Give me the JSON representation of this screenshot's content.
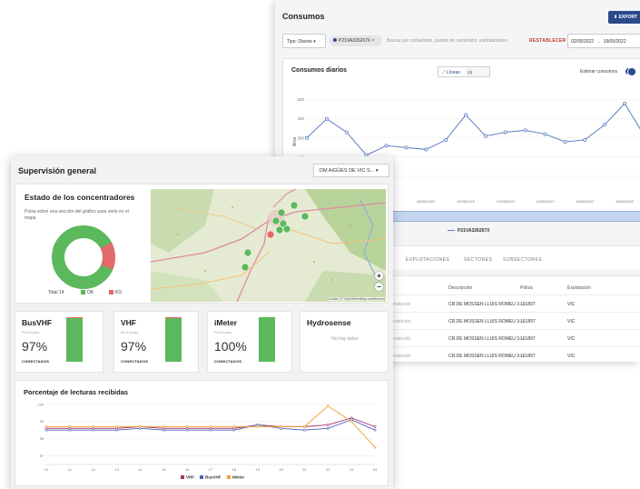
{
  "consumos": {
    "title": "Consumos",
    "export_label": "⬇ EXPORT",
    "tipo_label": "Tipo: Diarios ▾",
    "selected_chip": "P21VA326267X",
    "search_placeholder": "Buscar por contadores, puntos de suministro, explotaciones,",
    "reset_label": "RESTABLECER",
    "date_from": "02/05/2022",
    "date_to": "19/05/2022",
    "chart_title": "Consumos diarios",
    "view_lineas": "Líneas",
    "estimar_label": "Estimar consumos",
    "legend_series": "P21VA326267X",
    "tabs": [
      "EXPLOTACIONES",
      "SECTORES",
      "SUBSECTORES"
    ],
    "table_headers": [
      "Descripción",
      "Póliza",
      "Explotación"
    ],
    "rows": [
      {
        "intro": "ntroducido",
        "desc": "CR.DE MOSSEN LLUIS ROMEU 3-...",
        "poliza": "161897",
        "explot": "VIC"
      },
      {
        "intro": "ntroducido",
        "desc": "CR.DE MOSSEN LLUIS ROMEU 3-...",
        "poliza": "161897",
        "explot": "VIC"
      },
      {
        "intro": "ntroducido",
        "desc": "CR.DE MOSSEN LLUIS ROMEU 3-...",
        "poliza": "161897",
        "explot": "VIC"
      },
      {
        "intro": "ntroducido",
        "desc": "CR.DE MOSSEN LLUIS ROMEU 3-...",
        "poliza": "161897",
        "explot": "VIC"
      }
    ]
  },
  "supervision": {
    "title": "Supervisión general",
    "dm_select": "DM AIGÜES DE VIC S... ▾",
    "conc_title": "Estado de los concentradores",
    "conc_sub": "Pulsa sobre una sección del gráfico para verlo en el mapa",
    "total_label": "Total 14",
    "ok_label": "OK",
    "ko_label": "KO",
    "map_attrib": "Leaflet | © OpenStreetMap contributors",
    "cards": [
      {
        "name": "BusVHF",
        "sub": "Fa 3 hores",
        "value": "97%",
        "label": "CONECTADOS",
        "ok_fraction": 0.97
      },
      {
        "name": "VHF",
        "sub": "Fa 3 hores",
        "value": "97%",
        "label": "CONECTADOS",
        "ok_fraction": 0.97
      },
      {
        "name": "iMeter",
        "sub": "Fa 3 hores",
        "value": "100%",
        "label": "CONECTADOS",
        "ok_fraction": 1.0
      }
    ],
    "hydrosense": {
      "name": "Hydrosense",
      "no_data": "No hay datos"
    },
    "pct_title": "Porcentaje de lecturas recibidas"
  },
  "colors": {
    "ok": "#5cb85c",
    "ko": "#e26a6a",
    "vhf": "#a0306a",
    "busvhf": "#4a60b8",
    "imeter": "#f0a030",
    "consumo_line": "#5b7fc3"
  },
  "chart_data": [
    {
      "type": "line",
      "title": "Consumos diarios",
      "ylabel": "litros",
      "y_ticks": [
        "500",
        "400",
        "300",
        "200",
        "100"
      ],
      "x_ticks": [
        "08/05/2022",
        "10/05/2022",
        "12/05/2022",
        "14/05/2022",
        "16/05/2022",
        "18/05/2022"
      ],
      "ylim": [
        0,
        560
      ],
      "series": [
        {
          "name": "P21VA326267X",
          "values": [
            300,
            400,
            330,
            210,
            260,
            250,
            240,
            290,
            420,
            310,
            330,
            340,
            320,
            280,
            290,
            370,
            480,
            310
          ]
        }
      ]
    },
    {
      "type": "line",
      "title": "Porcentaje de lecturas recibidas",
      "categories": [
        "10",
        "11",
        "12",
        "13",
        "14",
        "15",
        "16",
        "17",
        "18",
        "19",
        "20",
        "21",
        "22",
        "23",
        "24"
      ],
      "y_ticks": [
        "100",
        "99",
        "98",
        "97"
      ],
      "ylim": [
        96.5,
        100.2
      ],
      "series": [
        {
          "name": "VHF",
          "values": [
            98.6,
            98.6,
            98.6,
            98.6,
            98.7,
            98.6,
            98.6,
            98.6,
            98.6,
            98.8,
            98.7,
            98.7,
            98.8,
            99.2,
            98.7
          ]
        },
        {
          "name": "BusVHF",
          "values": [
            98.5,
            98.5,
            98.5,
            98.5,
            98.6,
            98.5,
            98.5,
            98.5,
            98.5,
            98.8,
            98.6,
            98.5,
            98.6,
            99.1,
            98.5
          ]
        },
        {
          "name": "iMeter",
          "values": [
            98.7,
            98.7,
            98.7,
            98.7,
            98.7,
            98.7,
            98.7,
            98.7,
            98.7,
            98.7,
            98.7,
            98.7,
            99.9,
            99.0,
            97.5
          ]
        }
      ]
    }
  ]
}
